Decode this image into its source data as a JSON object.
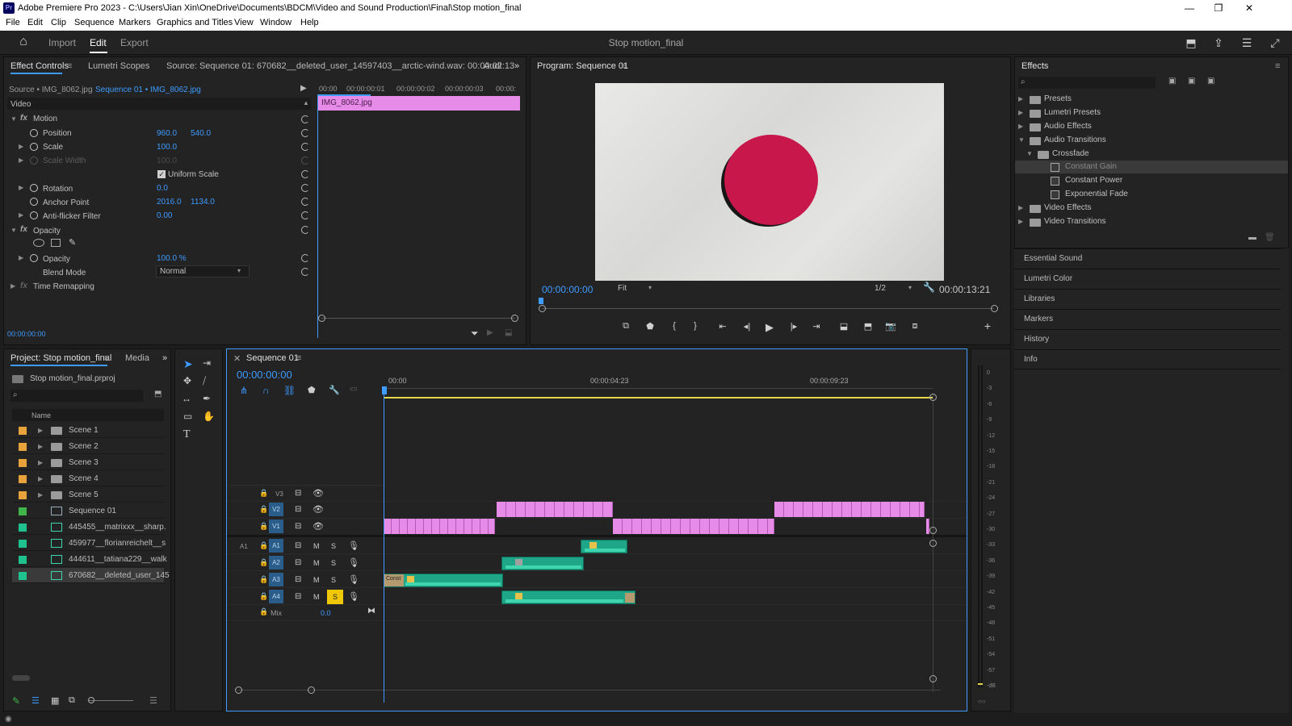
{
  "window": {
    "title": "Adobe Premiere Pro 2023 - C:\\Users\\Jian Xin\\OneDrive\\Documents\\BDCM\\Video and Sound Production\\Final\\Stop motion_final",
    "logo": "Pr",
    "minimize": "—",
    "maximize": "❐",
    "close": "✕"
  },
  "menu": [
    "File",
    "Edit",
    "Clip",
    "Sequence",
    "Markers",
    "Graphics and Titles",
    "View",
    "Window",
    "Help"
  ],
  "workspace": {
    "tabs": [
      "Import",
      "Edit",
      "Export"
    ],
    "active_tab": "Edit",
    "project_title": "Stop motion_final"
  },
  "effect_controls": {
    "tabs": [
      "Effect Controls",
      "Lumetri Scopes",
      "Source: Sequence 01: 670682__deleted_user_14597403__arctic-wind.wav: 00:00:02:13",
      "Audi"
    ],
    "source_label": "Source • IMG_8062.jpg",
    "sequence_label": "Sequence 01 • IMG_8062.jpg",
    "section": "Video",
    "ruler": [
      "00:00",
      "00:00:00:01",
      "00:00:00:02",
      "00:00:00:03",
      "00:00:"
    ],
    "clip_name": "IMG_8062.jpg",
    "motion": "Motion",
    "position_label": "Position",
    "position_x": "960.0",
    "position_y": "540.0",
    "scale_label": "Scale",
    "scale_val": "100.0",
    "scale_width_label": "Scale Width",
    "scale_width_val": "100.0",
    "uniform_scale": "Uniform Scale",
    "rotation_label": "Rotation",
    "rotation_val": "0.0",
    "anchor_label": "Anchor Point",
    "anchor_x": "2016.0",
    "anchor_y": "1134.0",
    "antiflicker_label": "Anti-flicker Filter",
    "antiflicker_val": "0.00",
    "opacity_group": "Opacity",
    "opacity_label": "Opacity",
    "opacity_val": "100.0 %",
    "blend_label": "Blend Mode",
    "blend_val": "Normal",
    "time_remap": "Time Remapping",
    "timecode": "00:00:00:00"
  },
  "program": {
    "title": "Program: Sequence 01",
    "timecode": "00:00:00:00",
    "fit": "Fit",
    "resolution": "1/2",
    "duration": "00:00:13:21",
    "red_circle_color": "#c8174a"
  },
  "effects": {
    "title": "Effects",
    "tree": [
      {
        "label": "Presets",
        "level": 0
      },
      {
        "label": "Lumetri Presets",
        "level": 0
      },
      {
        "label": "Audio Effects",
        "level": 0
      },
      {
        "label": "Audio Transitions",
        "level": 0
      },
      {
        "label": "Crossfade",
        "level": 1
      },
      {
        "label": "Constant Gain",
        "level": 2
      },
      {
        "label": "Constant Power",
        "level": 2
      },
      {
        "label": "Exponential Fade",
        "level": 2
      },
      {
        "label": "Video Effects",
        "level": 0
      },
      {
        "label": "Video Transitions",
        "level": 0
      }
    ],
    "side_panels": [
      "Essential Sound",
      "Lumetri Color",
      "Libraries",
      "Markers",
      "History",
      "Info"
    ]
  },
  "project": {
    "tabs": [
      "Project: Stop motion_final",
      "Media"
    ],
    "file": "Stop motion_final.prproj",
    "column": "Name",
    "items": [
      {
        "name": "Scene 1",
        "color": "#e8a23c"
      },
      {
        "name": "Scene 2",
        "color": "#e8a23c"
      },
      {
        "name": "Scene 3",
        "color": "#e8a23c"
      },
      {
        "name": "Scene 4",
        "color": "#e8a23c"
      },
      {
        "name": "Scene 5",
        "color": "#e8a23c"
      },
      {
        "name": "Sequence 01",
        "color": "#3fb54a"
      },
      {
        "name": "445455__matrixxx__sharp.",
        "color": "#1fc28f"
      },
      {
        "name": "459977__florianreichelt__s",
        "color": "#1fc28f"
      },
      {
        "name": "444611__tatiana229__walk",
        "color": "#1fc28f"
      },
      {
        "name": "670682__deleted_user_145",
        "color": "#1fc28f"
      }
    ]
  },
  "timeline": {
    "tab": "Sequence 01",
    "timecode": "00:00:00:00",
    "ruler": [
      "00:00",
      "00:00:04:23",
      "00:00:09:23"
    ],
    "video_tracks": [
      "V3",
      "V2",
      "V1"
    ],
    "audio_tracks": [
      "A1",
      "A2",
      "A3",
      "A4"
    ],
    "a1_source": "A1",
    "mix_label": "Mix",
    "mix_val": "0.0",
    "clip_text": "Const"
  },
  "meter": {
    "scale": [
      "0",
      "-3",
      "-6",
      "-9",
      "-12",
      "-15",
      "-18",
      "-21",
      "-24",
      "-27",
      "-30",
      "-33",
      "-36",
      "-39",
      "-42",
      "-45",
      "-48",
      "-51",
      "-54",
      "-57",
      "-dB"
    ]
  }
}
